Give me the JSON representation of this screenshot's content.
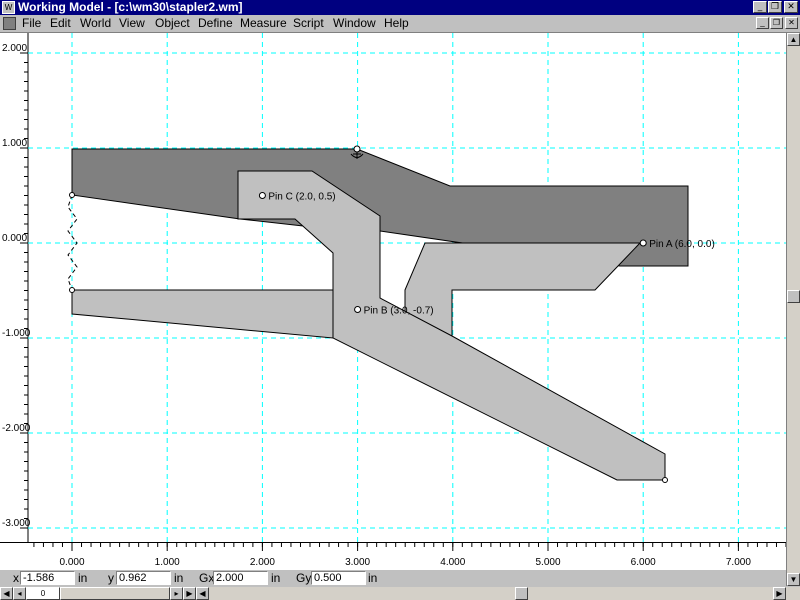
{
  "window": {
    "title": "Working Model - [c:\\wm30\\stapler2.wm]"
  },
  "menu": [
    {
      "label": "File",
      "key": "File"
    },
    {
      "label": "Edit",
      "key": "Edit"
    },
    {
      "label": "World",
      "key": "World"
    },
    {
      "label": "View",
      "key": "View"
    },
    {
      "label": "Object",
      "key": "Object"
    },
    {
      "label": "Define",
      "key": "Define"
    },
    {
      "label": "Measure",
      "key": "Measure"
    },
    {
      "label": "Script",
      "key": "Script"
    },
    {
      "label": "Window",
      "key": "Window"
    },
    {
      "label": "Help",
      "key": "Help"
    }
  ],
  "axes": {
    "y_ticks": [
      "2.000",
      "1.000",
      "0.000",
      "-1.000",
      "-2.000",
      "-3.000"
    ],
    "x_ticks": [
      "0.000",
      "1.000",
      "2.000",
      "3.000",
      "4.000",
      "5.000",
      "6.000",
      "7.000"
    ],
    "grid_color": "#00ffff"
  },
  "pins": [
    {
      "label": "Pin C (2.0, 0.5)",
      "x": 2.0,
      "y": 0.5
    },
    {
      "label": "Pin B (3.0, -0.7)",
      "x": 3.0,
      "y": -0.7
    },
    {
      "label": "Pin A (6.0, 0.0)",
      "x": 6.0,
      "y": 0.0
    }
  ],
  "colors": {
    "dark_body": "#808080",
    "light_body": "#c0c0c0",
    "titlebar": "#000080"
  },
  "coords": {
    "x_label": "x",
    "x_value": "-1.586",
    "x_unit": "in",
    "y_label": "y",
    "y_value": "0.962",
    "y_unit": "in",
    "gx_label": "Gx",
    "gx_value": "2.000",
    "gx_unit": "in",
    "gy_label": "Gy",
    "gy_value": "0.500",
    "gy_unit": "in"
  },
  "tape": {
    "frame": "0"
  }
}
